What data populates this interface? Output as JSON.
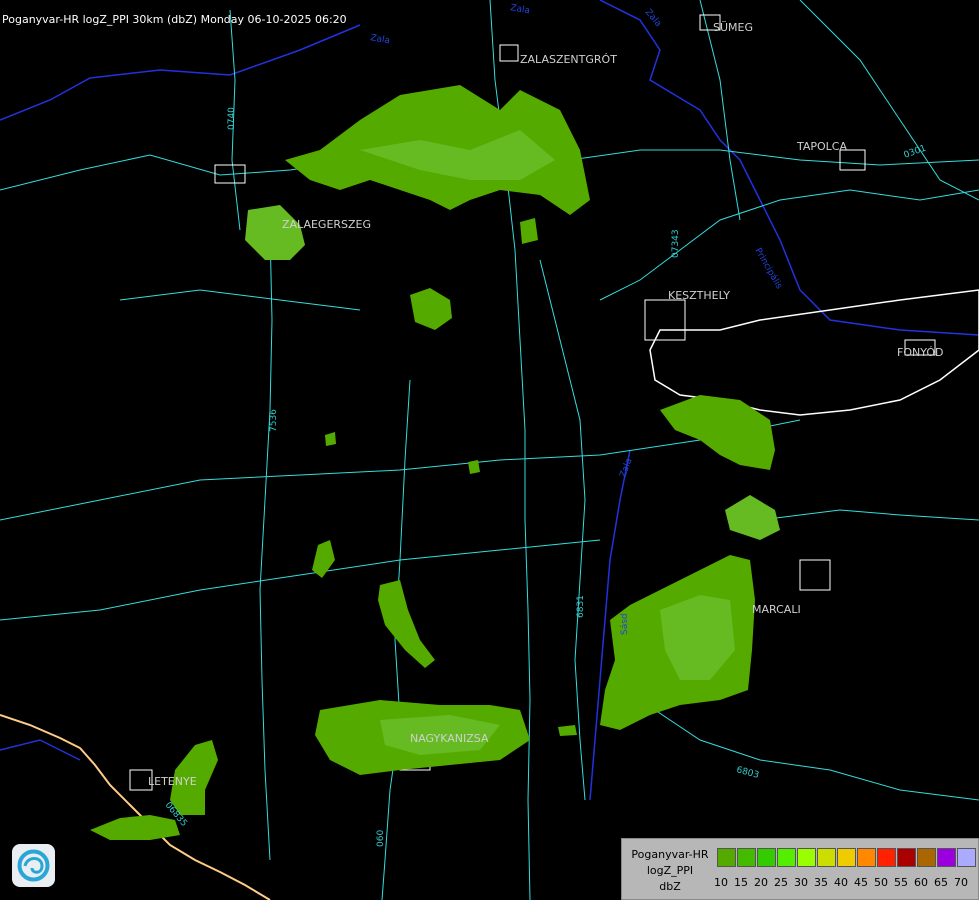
{
  "title": "Poganyvar-HR logZ_PPI 30km (dbZ) Monday 06-10-2025 06:20",
  "places": [
    {
      "name": "SÜMEG",
      "id": "sumeg"
    },
    {
      "name": "ZALASZENTGRÓT",
      "id": "zalaszentgrot"
    },
    {
      "name": "TAPOLCA",
      "id": "tapolca"
    },
    {
      "name": "ZALAEGERSZEG",
      "id": "zalaegerszeg"
    },
    {
      "name": "KESZTHELY",
      "id": "keszthely"
    },
    {
      "name": "FONYÓD",
      "id": "fonyod"
    },
    {
      "name": "MARCALI",
      "id": "marcali"
    },
    {
      "name": "NAGYKANIZSA",
      "id": "nagykanizsa"
    },
    {
      "name": "LETENYE",
      "id": "letenye"
    }
  ],
  "roads": [
    "0740",
    "07343",
    "0301",
    "7536",
    "6831",
    "06835",
    "6803",
    "060"
  ],
  "rivers": [
    "Zala",
    "Zala",
    "Principális",
    "Zala",
    "Sásd",
    "Zala"
  ],
  "legend": {
    "name_line1": "Poganyvar-HR",
    "name_line2": "logZ_PPI",
    "name_line3": "dbZ",
    "levels": [
      10,
      15,
      20,
      25,
      30,
      35,
      40,
      45,
      50,
      55,
      60,
      65,
      70
    ],
    "colors": [
      "#55aa00",
      "#44bb00",
      "#33cc00",
      "#55ee00",
      "#99ff00",
      "#ccdd00",
      "#eecc00",
      "#ff8800",
      "#ff2200",
      "#aa0000",
      "#aa6600",
      "#9900dd",
      "#aaaaff"
    ]
  }
}
